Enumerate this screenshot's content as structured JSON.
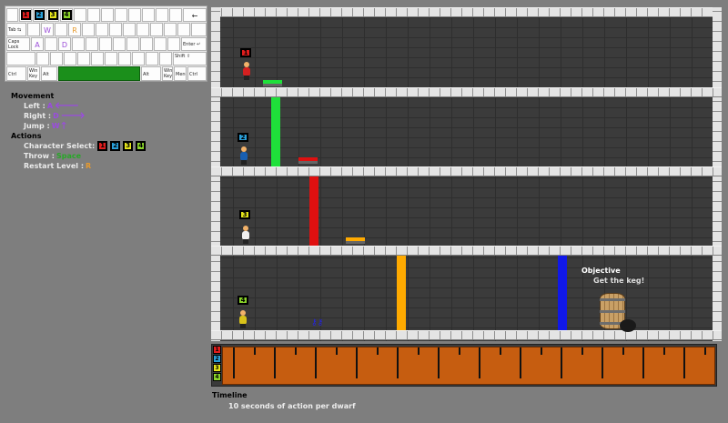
{
  "keyboard": {
    "keys": {
      "tab": "Tab ⇆",
      "caps": "Caps Lock",
      "enter": "Enter ↵",
      "shift": "Shift ⇧",
      "ctrl": "Ctrl",
      "win": "Win Key",
      "alt": "Alt",
      "menu": "Menu",
      "backspace": "←",
      "w": "W",
      "r": "R",
      "a": "A",
      "d": "D"
    },
    "number_keys": [
      "1",
      "2",
      "3",
      "4"
    ],
    "number_colors": [
      "#e01d1d",
      "#2a9fd8",
      "#e5e51b",
      "#8ad32a"
    ]
  },
  "controls": {
    "movement_heading": "Movement",
    "left_label": "Left :",
    "left_key": "A",
    "right_label": "Right :",
    "right_key": "D",
    "jump_label": "Jump :",
    "jump_key": "W",
    "actions_heading": "Actions",
    "select_label": "Character Select:",
    "throw_label": "Throw :",
    "throw_key": "Space",
    "restart_label": "Restart Level :",
    "restart_key": "R"
  },
  "level": {
    "doors": [
      {
        "color": "#1fe03a",
        "floor": 1
      },
      {
        "color": "#e01010",
        "floor": 2
      },
      {
        "color": "#ffaa00",
        "floor": 3
      },
      {
        "color": "#1018e8",
        "floor": 3
      }
    ],
    "plates": [
      {
        "color": "#1fe03a",
        "floor": 0
      },
      {
        "color": "#e01010",
        "floor": 1
      },
      {
        "color": "#ffaa00",
        "floor": 2
      }
    ],
    "dwarves": [
      {
        "number": "1",
        "tag_color": "#e01d1d",
        "body_color": "#d42020",
        "floor": 0
      },
      {
        "number": "2",
        "tag_color": "#2a9fd8",
        "body_color": "#1a5fb0",
        "floor": 1
      },
      {
        "number": "3",
        "tag_color": "#e5e51b",
        "body_color": "#f0f0f0",
        "floor": 2
      },
      {
        "number": "4",
        "tag_color": "#8ad32a",
        "body_color": "#d8c21a",
        "floor": 3
      }
    ],
    "objective_title": "Objective",
    "objective_text": "Get the keg!"
  },
  "timeline": {
    "title": "Timeline",
    "subtitle": "10 seconds of action per dwarf",
    "badges": [
      "1",
      "2",
      "3",
      "4"
    ],
    "bar_color": "#c65d10",
    "ticks": 24
  }
}
